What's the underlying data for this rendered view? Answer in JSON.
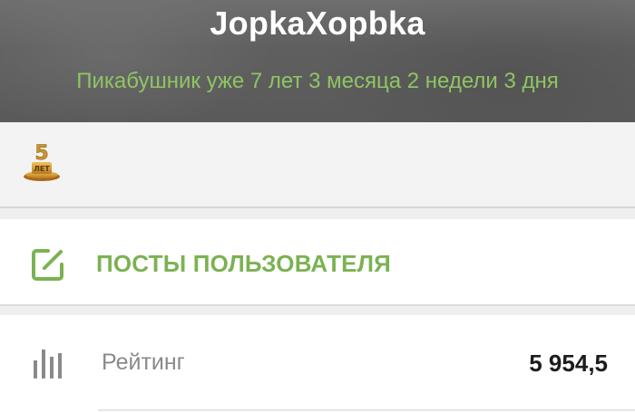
{
  "profile": {
    "username": "JopkaXopbka",
    "tenure": "Пикабушник уже 7 лет 3 месяца 2 недели 3 дня"
  },
  "awards": [
    {
      "icon": "five-years-award-icon",
      "label": "5 ЛЕТ",
      "accent": "#c9962e"
    }
  ],
  "menu": {
    "posts_label": "ПОСТЫ ПОЛЬЗОВАТЕЛЯ",
    "posts_icon": "edit-icon"
  },
  "stats": {
    "rating_label": "Рейтинг",
    "rating_value": "5 954,5",
    "rating_icon": "bar-chart-icon"
  },
  "colors": {
    "accent_green": "#7bb252",
    "tenure_green": "#8fc563",
    "header_bg": "#5f5f5f"
  }
}
